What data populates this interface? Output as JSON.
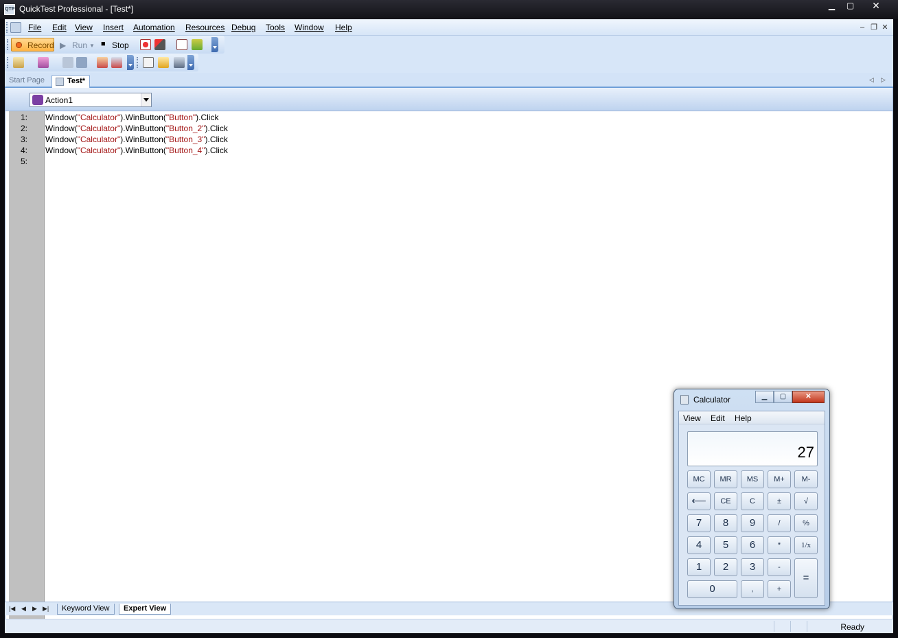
{
  "window": {
    "title": "QuickTest Professional - [Test*]",
    "app_icon_text": "QTP"
  },
  "menu": [
    "File",
    "Edit",
    "View",
    "Insert",
    "Automation",
    "Resources",
    "Debug",
    "Tools",
    "Window",
    "Help"
  ],
  "toolbar": {
    "record": "Record",
    "run": "Run",
    "stop": "Stop"
  },
  "tabs": {
    "start_page": "Start Page",
    "test": "Test*"
  },
  "action_combo": {
    "value": "Action1"
  },
  "code": {
    "line_numbers": [
      "1:",
      "2:",
      "3:",
      "4:",
      "5:"
    ],
    "lines": [
      {
        "pre": "Window(",
        "s1": "\"Calculator\"",
        "mid": ").WinButton(",
        "s2": "\"Button\"",
        "post": ").Click"
      },
      {
        "pre": "Window(",
        "s1": "\"Calculator\"",
        "mid": ").WinButton(",
        "s2": "\"Button_2\"",
        "post": ").Click"
      },
      {
        "pre": "Window(",
        "s1": "\"Calculator\"",
        "mid": ").WinButton(",
        "s2": "\"Button_3\"",
        "post": ").Click"
      },
      {
        "pre": "Window(",
        "s1": "\"Calculator\"",
        "mid": ").WinButton(",
        "s2": "\"Button_4\"",
        "post": ").Click"
      }
    ]
  },
  "view_tabs": {
    "keyword": "Keyword View",
    "expert": "Expert View"
  },
  "status": {
    "text": "Ready"
  },
  "calculator": {
    "title": "Calculator",
    "menu": {
      "view": "View",
      "edit": "Edit",
      "help": "Help"
    },
    "display": "27",
    "keys": {
      "mc": "MC",
      "mr": "MR",
      "ms": "MS",
      "mplus": "M+",
      "mminus": "M-",
      "back": "⟵",
      "ce": "CE",
      "c": "C",
      "plusminus": "±",
      "sqrt": "√",
      "k7": "7",
      "k8": "8",
      "k9": "9",
      "div": "/",
      "pct": "%",
      "k4": "4",
      "k5": "5",
      "k6": "6",
      "mul": "*",
      "recip": "1/x",
      "k1": "1",
      "k2": "2",
      "k3": "3",
      "sub": "-",
      "eq": "=",
      "k0": "0",
      "dot": ",",
      "add": "+"
    }
  }
}
